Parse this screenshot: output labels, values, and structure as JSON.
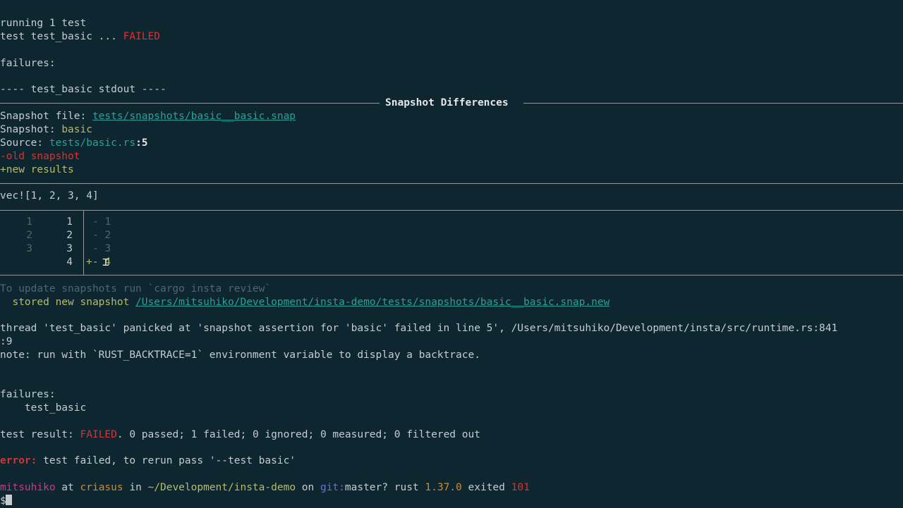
{
  "terminal": {
    "running": "running 1 test",
    "test_line_prefix": "test test_basic ... ",
    "test_line_status": "FAILED",
    "failures_label": "failures:",
    "stdout_header": "---- test_basic stdout ----",
    "snapshot_title": "Snapshot Differences",
    "snapshot_file_label": "Snapshot file: ",
    "snapshot_file_value": "tests/snapshots/basic__basic.snap",
    "snapshot_label": "Snapshot: ",
    "snapshot_value": "basic",
    "source_label": "Source: ",
    "source_value": "tests/basic.rs",
    "source_line": ":5",
    "old_marker": "-old snapshot",
    "new_marker": "+new results",
    "expression": "vec![1, 2, 3, 4]",
    "diff": [
      {
        "old": "1",
        "new": "1",
        "text": "- 1"
      },
      {
        "old": "2",
        "new": "2",
        "text": "- 2"
      },
      {
        "old": "3",
        "new": "3",
        "text": "- 3"
      },
      {
        "old": "",
        "new": "4",
        "text": "+- 4"
      }
    ],
    "update_hint": "To update snapshots run `cargo insta review`",
    "stored_prefix": "  stored new snapshot ",
    "stored_path": "/Users/mitsuhiko/Development/insta-demo/tests/snapshots/basic__basic.snap.new",
    "panic_line1": "thread 'test_basic' panicked at 'snapshot assertion for 'basic' failed in line 5', /Users/mitsuhiko/Development/insta/src/runtime.rs:841",
    "panic_line2": ":9",
    "note_line": "note: run with `RUST_BACKTRACE=1` environment variable to display a backtrace.",
    "failures_label2": "failures:",
    "failed_test": "    test_basic",
    "result_prefix": "test result: ",
    "result_status": "FAILED",
    "result_rest": ". 0 passed; 1 failed; 0 ignored; 0 measured; 0 filtered out",
    "error_label": "error:",
    "error_rest": " test failed, to rerun pass '--test basic'",
    "prompt": {
      "user": "mitsuhiko",
      "at": " at ",
      "host": "criasus",
      "in": " in ",
      "cwd": "~/Development/insta-demo",
      "on": " on ",
      "git_label": "git:",
      "branch": "master?",
      "rust_label": " rust ",
      "rust_version": "1.37.0",
      "exited_label": " exited ",
      "exit_code": "101",
      "symbol": "$ "
    }
  }
}
